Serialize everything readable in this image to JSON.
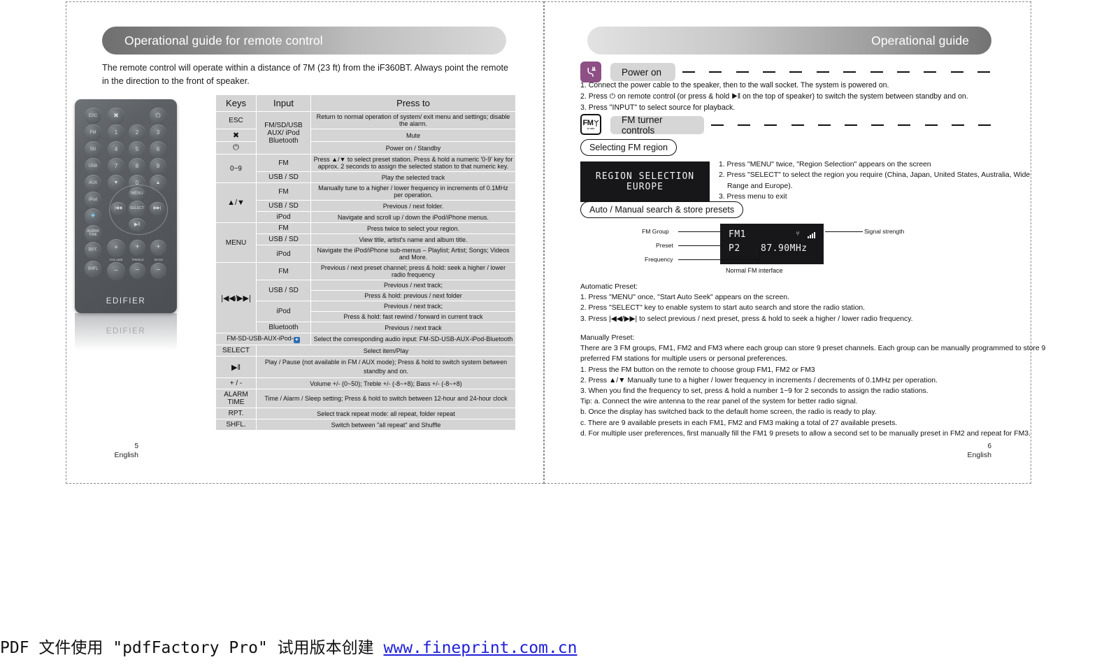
{
  "document": {
    "watermark_prefix": "PDF  文件使用 \"pdfFactory Pro\"  试用版本创建 ",
    "watermark_url": "www.fineprint.com.cn"
  },
  "left_page": {
    "banner_title": "Operational guide for remote control",
    "intro": "The remote control will operate within a distance of 7M (23 ft) from the iF360BT. Always point the remote in the direction to the front of speaker.",
    "page_number": "5",
    "language": "English",
    "remote": {
      "brand": "EDIFIER",
      "buttons": [
        "ESC",
        "MUTE",
        "POWER",
        "FM",
        "1",
        "2",
        "3",
        "SD",
        "4",
        "5",
        "6",
        "USB",
        "7",
        "8",
        "9",
        "AUX",
        "DOWN",
        "0",
        "UP",
        "iPod",
        "MENU",
        "BT",
        "PREV",
        "SELECT",
        "NEXT",
        "ALARM TIME",
        "PLAY/PAUSE",
        "RPT.",
        "SHFL"
      ],
      "knob_labels": [
        "VOLUME",
        "TREBLE",
        "BASS"
      ]
    },
    "table": {
      "headers": [
        "Keys",
        "Input",
        "Press to"
      ],
      "rows": [
        {
          "key": "ESC",
          "input": "FM/SD/USB AUX/ iPod Bluetooth",
          "press": "Return to normal operation of system/ exit menu and settings; disable the alarm."
        },
        {
          "key": "✖",
          "input": "",
          "press": "Mute"
        },
        {
          "key": "⏻",
          "input": "",
          "press": "Power on / Standby"
        },
        {
          "key": "0~9",
          "input": "FM",
          "press": "Press ▲/▼ to select preset station. Press & hold a numeric '0-9' key for approx. 2 seconds to assign the selected station to that numeric key."
        },
        {
          "key": "",
          "input": "USB / SD",
          "press": "Play the selected track"
        },
        {
          "key": "▲/▼",
          "input": "FM",
          "press": "Manually tune to a higher / lower frequency in increments of 0.1MHz per operation."
        },
        {
          "key": "",
          "input": "USB / SD",
          "press": "Previous / next folder."
        },
        {
          "key": "",
          "input": "iPod",
          "press": "Navigate and scroll up / down the iPod/iPhone menus."
        },
        {
          "key": "MENU",
          "input": "FM",
          "press": "Press twice to select your region."
        },
        {
          "key": "",
          "input": "USB / SD",
          "press": "View title, artist's name and album title."
        },
        {
          "key": "",
          "input": "iPod",
          "press": "Navigate the iPod/iPhone sub-menus – Playlist; Artist; Songs; Videos and More."
        },
        {
          "key": "|◀◀/▶▶|",
          "input": "FM",
          "press": "Previous / next preset channel; press & hold: seek a higher / lower radio frequency"
        },
        {
          "key": "",
          "input": "USB / SD",
          "press": "Previous / next track;"
        },
        {
          "key": "",
          "input": "",
          "press": "Press & hold: previous / next folder"
        },
        {
          "key": "",
          "input": "iPod",
          "press": "Previous / next track;"
        },
        {
          "key": "",
          "input": "",
          "press": "Press & hold: fast rewind / forward in current track"
        },
        {
          "key": "",
          "input": "Bluetooth",
          "press": "Previous / next track"
        },
        {
          "key": "FM-SD-USB-AUX-iPod-",
          "input": "",
          "press": "Select the corresponding audio input: FM-SD-USB-AUX-iPod-Bluetooth"
        },
        {
          "key": "SELECT",
          "input": "",
          "press": "Select item/Play"
        },
        {
          "key": "▶‖",
          "input": "",
          "press": "Play / Pause (not available in FM / AUX mode); Press & hold to switch system between standby and on."
        },
        {
          "key": "+ / -",
          "input": "",
          "press": "Volume +/- (0~50); Treble +/- (-8~+8); Bass +/- (-8~+8)"
        },
        {
          "key": "ALARM TIME",
          "input": "",
          "press": "Time / Alarm / Sleep setting; Press & hold to switch between 12-hour and 24-hour clock"
        },
        {
          "key": "RPT.",
          "input": "",
          "press": "Select track repeat mode: all repeat, folder repeat"
        },
        {
          "key": "SHFL.",
          "input": "",
          "press": "Switch between \"all repeat\" and Shuffle"
        }
      ]
    }
  },
  "right_page": {
    "banner_title": "Operational guide",
    "page_number": "6",
    "language": "English",
    "power_section": {
      "icon": "power-plug-icon",
      "pill_label": "Power on",
      "steps": [
        "1. Connect the power cable to the speaker, then to the wall socket. The system is powered on.",
        "2. Press ⏻ on remote control (or press & hold ▶‖ on the top of speaker) to switch the system between standby and on.",
        "3. Press \"INPUT\" to select source for playback."
      ]
    },
    "fm_section": {
      "icon_text": "FM",
      "icon_sub": "for radio",
      "pill_label": "FM turner controls",
      "region_title": "Selecting FM region",
      "region_lcd": {
        "line1": "REGION SELECTION",
        "line2": "EUROPE"
      },
      "region_steps": [
        "1. Press \"MENU\" twice, \"Region Selection\" appears on the screen",
        "2. Press \"SELECT\" to select the region you require (China, Japan, United States, Australia, Wide",
        "Range and Europe).",
        "3. Press menu to exit"
      ],
      "presets_title": "Auto / Manual search & store presets",
      "display": {
        "callout_group": "FM Group",
        "callout_preset": "Preset",
        "callout_frequency": "Frequency",
        "callout_signal": "Signal strength",
        "group_value": "FM1",
        "preset_value": "P2",
        "frequency_value": "87.90MHz",
        "caption": "Normal FM interface"
      },
      "auto_preset": {
        "title": "Automatic Preset:",
        "steps": [
          "1. Press \"MENU\" once, \"Start Auto Seek\" appears on the screen.",
          "2. Press \"SELECT\" key to enable system to start auto search and store the radio station.",
          "3. Press |◀◀/▶▶| to select previous / next preset, press & hold to seek a higher / lower radio frequency."
        ]
      },
      "manual_preset": {
        "title": "Manually Preset:",
        "paragraph_line1": "There are 3 FM groups, FM1, FM2 and FM3 where each group can store 9 preset channels. Each group can be manually programmed to store 9",
        "paragraph_line2": "preferred FM stations for multiple users or personal preferences.",
        "steps": [
          "1. Press the FM button on the remote to choose group FM1, FM2 or FM3",
          "2. Press ▲/▼ Manually tune to a higher / lower frequency in increments / decrements of 0.1MHz per operation.",
          "3. When you find the frequency to set, press & hold a number 1~9 for 2 seconds to assign the radio stations.",
          "Tip: a. Connect the wire antenna to the rear panel of the system for better radio signal.",
          "b. Once the display has switched back to the default home screen, the radio is ready to play.",
          "c. There are 9 available presets in each FM1, FM2 and FM3 making a total of 27 available presets.",
          "d. For multiple user preferences, first manually fill the FM1 9 presets to allow a second set to be manually preset in FM2 and repeat for FM3."
        ]
      }
    }
  },
  "colors": {
    "banner_dark": "#6f6f6f",
    "banner_light": "#d9d9d9",
    "table_cell": "#d4d4d4",
    "power_icon": "#8e4f85",
    "lcd_bg": "#17171a",
    "link": "#2020d8"
  }
}
